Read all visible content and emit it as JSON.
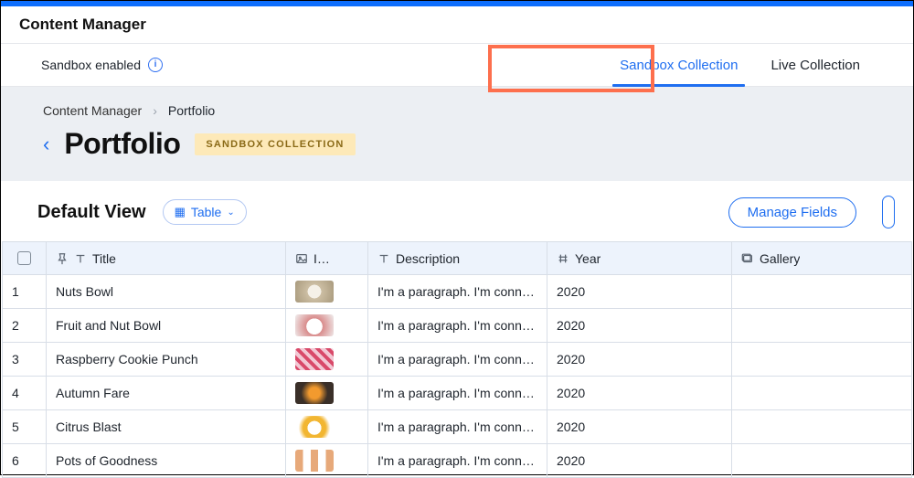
{
  "header": {
    "title": "Content Manager"
  },
  "subheader": {
    "sandbox_label": "Sandbox enabled",
    "tabs": {
      "sandbox": "Sandbox Collection",
      "live": "Live Collection"
    }
  },
  "breadcrumb": {
    "root": "Content Manager",
    "current": "Portfolio"
  },
  "page": {
    "title": "Portfolio",
    "badge": "SANDBOX COLLECTION"
  },
  "view": {
    "name": "Default View",
    "mode": "Table",
    "manage_fields": "Manage Fields"
  },
  "columns": {
    "title": "Title",
    "image": "I…",
    "description": "Description",
    "year": "Year",
    "gallery": "Gallery"
  },
  "rows": [
    {
      "n": "1",
      "title": "Nuts Bowl",
      "desc": "I'm a paragraph. I'm conn…",
      "year": "2020",
      "thumb": "t1"
    },
    {
      "n": "2",
      "title": "Fruit and Nut Bowl",
      "desc": "I'm a paragraph. I'm conn…",
      "year": "2020",
      "thumb": "t2"
    },
    {
      "n": "3",
      "title": "Raspberry Cookie Punch",
      "desc": "I'm a paragraph. I'm conn…",
      "year": "2020",
      "thumb": "t3"
    },
    {
      "n": "4",
      "title": "Autumn Fare",
      "desc": "I'm a paragraph. I'm conn…",
      "year": "2020",
      "thumb": "t4"
    },
    {
      "n": "5",
      "title": "Citrus Blast",
      "desc": "I'm a paragraph. I'm conn…",
      "year": "2020",
      "thumb": "t5"
    },
    {
      "n": "6",
      "title": "Pots of Goodness",
      "desc": "I'm a paragraph. I'm conn…",
      "year": "2020",
      "thumb": "t6"
    }
  ]
}
